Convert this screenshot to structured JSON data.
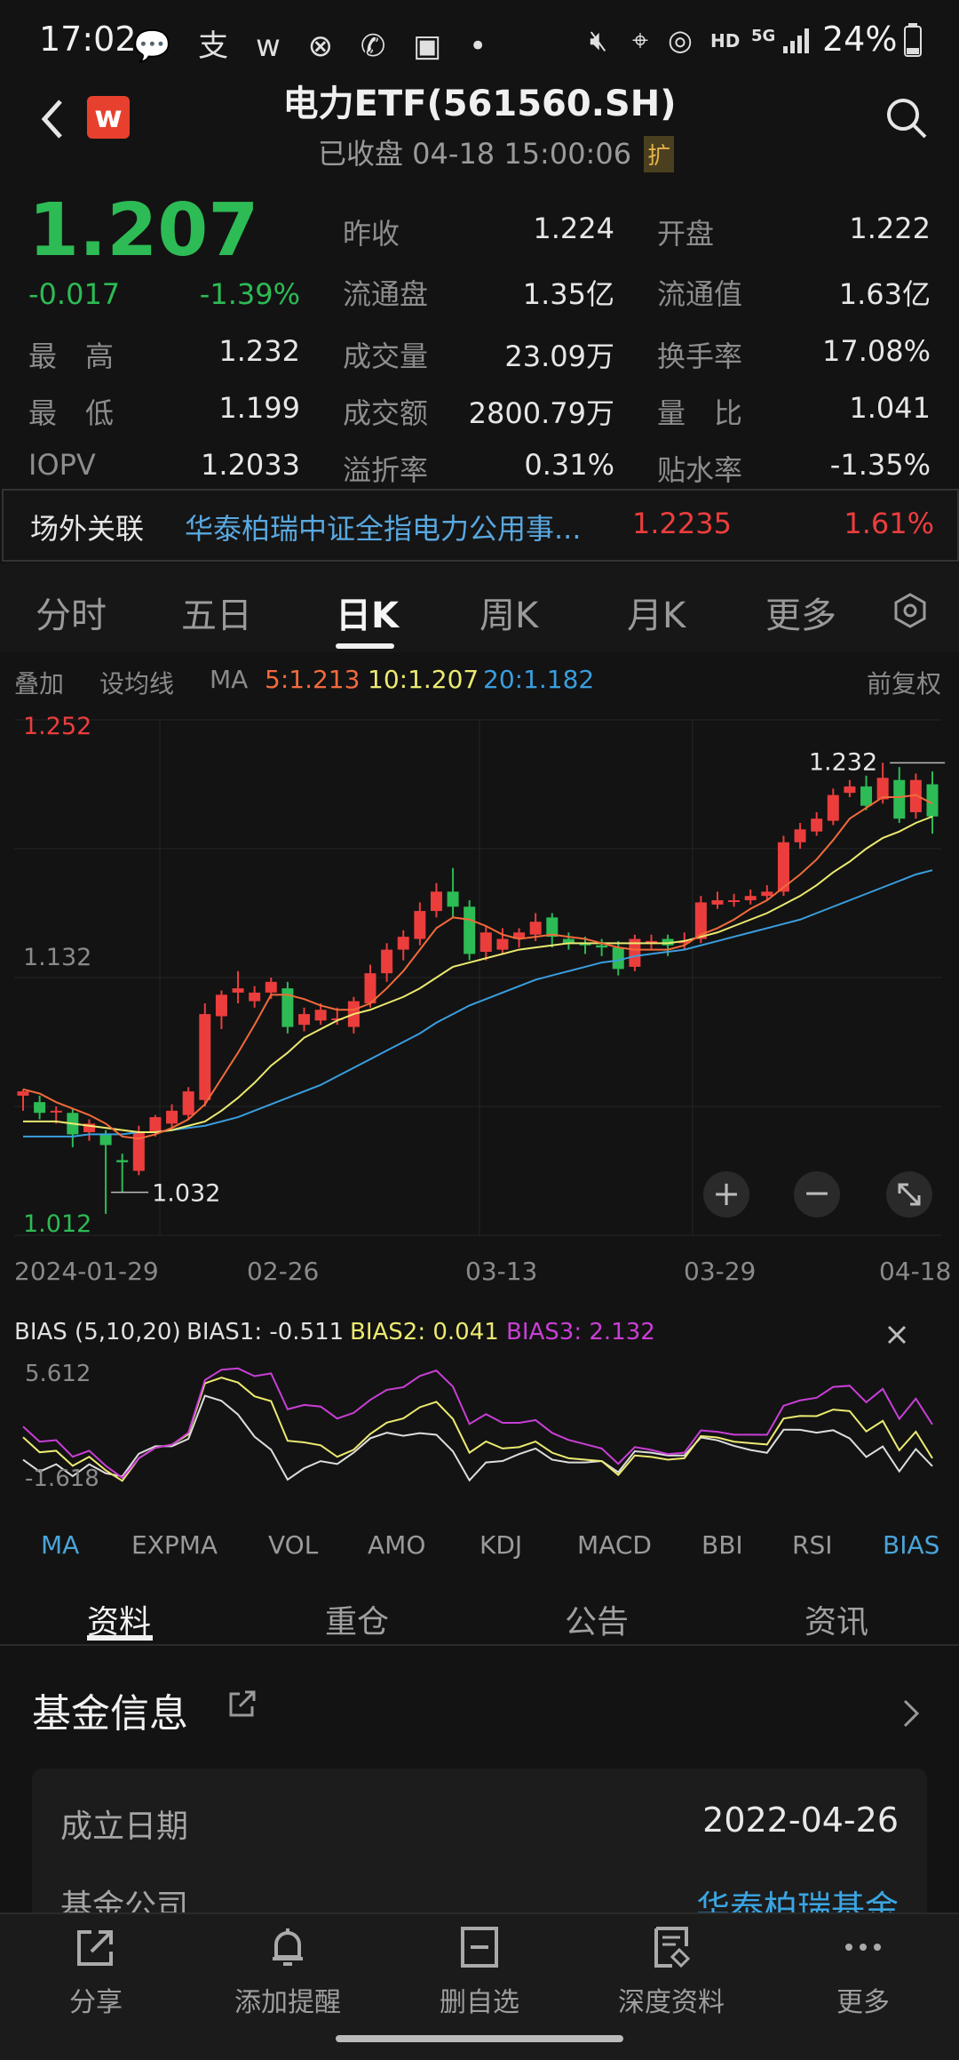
{
  "status_bar": {
    "time": "17:02",
    "battery": "24%",
    "net": "HD",
    "net2": "5G"
  },
  "header": {
    "title": "电力ETF(561560.SH)",
    "subtitle": "已收盘 04-18 15:00:06",
    "expand": "扩"
  },
  "quote": {
    "price": "1.207",
    "change": "-0.017",
    "change_pct": "-1.39%",
    "high_label": "最　高",
    "high": "1.232",
    "low_label": "最　低",
    "low": "1.199",
    "iopv_label": "IOPV",
    "iopv": "1.2033",
    "prev_close_label": "昨收",
    "prev_close": "1.224",
    "open_label": "开盘",
    "open": "1.222",
    "float_shares_label": "流通盘",
    "float_shares": "1.35亿",
    "float_value_label": "流通值",
    "float_value": "1.63亿",
    "volume_label": "成交量",
    "volume": "23.09万",
    "turnover_rate_label": "换手率",
    "turnover_rate": "17.08%",
    "amount_label": "成交额",
    "amount": "2800.79万",
    "vol_ratio_label": "量　比",
    "vol_ratio": "1.041",
    "premium_label": "溢折率",
    "premium": "0.31%",
    "discount_label": "贴水率",
    "discount": "-1.35%"
  },
  "related": {
    "label": "场外关联",
    "name": "华泰柏瑞中证全指电力公用事...",
    "value": "1.2235",
    "pct": "1.61%"
  },
  "period_tabs": [
    "分时",
    "五日",
    "日K",
    "周K",
    "月K",
    "更多"
  ],
  "ma_bar": {
    "overlay": "叠加",
    "set_ma": "设均线",
    "ma": "MA",
    "ma5": "5:1.213",
    "ma10": "10:1.207",
    "ma20": "20:1.182",
    "adjust": "前复权"
  },
  "colors": {
    "up": "#ec3d3d",
    "down": "#2dbb55",
    "ma5": "#f26a3b",
    "ma10": "#ecea70",
    "ma20": "#3a9ede",
    "bias3": "#c93fd6"
  },
  "chart_data": {
    "type": "candlestick",
    "y_max_label": "1.252",
    "y_mid_label": "1.132",
    "y_min_label": "1.012",
    "max_marker": "1.232",
    "min_marker": "1.032",
    "x_labels": [
      "2024-01-29",
      "02-26",
      "03-13",
      "03-29",
      "04-18"
    ],
    "candles": [
      [
        1.077,
        1.079,
        1.08,
        1.07
      ],
      [
        1.074,
        1.069,
        1.077,
        1.066
      ],
      [
        1.07,
        1.07,
        1.072,
        1.064
      ],
      [
        1.069,
        1.059,
        1.071,
        1.053
      ],
      [
        1.06,
        1.064,
        1.066,
        1.056
      ],
      [
        1.059,
        1.054,
        1.061,
        1.022
      ],
      [
        1.047,
        1.046,
        1.05,
        1.032
      ],
      [
        1.042,
        1.06,
        1.063,
        1.04
      ],
      [
        1.06,
        1.067,
        1.068,
        1.058
      ],
      [
        1.064,
        1.07,
        1.073,
        1.062
      ],
      [
        1.068,
        1.079,
        1.081,
        1.066
      ],
      [
        1.075,
        1.115,
        1.12,
        1.072
      ],
      [
        1.114,
        1.124,
        1.126,
        1.108
      ],
      [
        1.125,
        1.127,
        1.135,
        1.12
      ],
      [
        1.121,
        1.125,
        1.128,
        1.118
      ],
      [
        1.125,
        1.13,
        1.132,
        1.122
      ],
      [
        1.127,
        1.109,
        1.13,
        1.106
      ],
      [
        1.11,
        1.115,
        1.118,
        1.107
      ],
      [
        1.112,
        1.117,
        1.12,
        1.11
      ],
      [
        1.113,
        1.113,
        1.118,
        1.11
      ],
      [
        1.109,
        1.121,
        1.123,
        1.106
      ],
      [
        1.12,
        1.134,
        1.138,
        1.118
      ],
      [
        1.134,
        1.145,
        1.148,
        1.13
      ],
      [
        1.145,
        1.151,
        1.154,
        1.14
      ],
      [
        1.15,
        1.163,
        1.167,
        1.147
      ],
      [
        1.163,
        1.172,
        1.176,
        1.16
      ],
      [
        1.172,
        1.165,
        1.183,
        1.16
      ],
      [
        1.165,
        1.143,
        1.168,
        1.14
      ],
      [
        1.144,
        1.153,
        1.156,
        1.14
      ],
      [
        1.145,
        1.15,
        1.155,
        1.143
      ],
      [
        1.15,
        1.153,
        1.155,
        1.146
      ],
      [
        1.152,
        1.158,
        1.162,
        1.149
      ],
      [
        1.16,
        1.151,
        1.162,
        1.146
      ],
      [
        1.15,
        1.148,
        1.153,
        1.145
      ],
      [
        1.148,
        1.147,
        1.151,
        1.143
      ],
      [
        1.147,
        1.146,
        1.15,
        1.142
      ],
      [
        1.146,
        1.136,
        1.149,
        1.133
      ],
      [
        1.137,
        1.15,
        1.152,
        1.135
      ],
      [
        1.149,
        1.149,
        1.152,
        1.145
      ],
      [
        1.15,
        1.147,
        1.152,
        1.142
      ],
      [
        1.148,
        1.149,
        1.153,
        1.145
      ],
      [
        1.15,
        1.167,
        1.17,
        1.148
      ],
      [
        1.166,
        1.168,
        1.172,
        1.164
      ],
      [
        1.168,
        1.168,
        1.171,
        1.165
      ],
      [
        1.168,
        1.17,
        1.173,
        1.166
      ],
      [
        1.17,
        1.172,
        1.175,
        1.168
      ],
      [
        1.172,
        1.195,
        1.198,
        1.17
      ],
      [
        1.195,
        1.201,
        1.204,
        1.192
      ],
      [
        1.2,
        1.206,
        1.209,
        1.198
      ],
      [
        1.205,
        1.217,
        1.22,
        1.203
      ],
      [
        1.218,
        1.221,
        1.224,
        1.216
      ],
      [
        1.221,
        1.212,
        1.226,
        1.21
      ],
      [
        1.215,
        1.225,
        1.232,
        1.213
      ],
      [
        1.224,
        1.206,
        1.23,
        1.204
      ],
      [
        1.209,
        1.224,
        1.227,
        1.206
      ],
      [
        1.222,
        1.207,
        1.228,
        1.199
      ]
    ],
    "ma5": [
      1.08,
      1.078,
      1.074,
      1.071,
      1.068,
      1.064,
      1.058,
      1.057,
      1.059,
      1.062,
      1.066,
      1.073,
      1.085,
      1.097,
      1.11,
      1.124,
      1.124,
      1.122,
      1.119,
      1.117,
      1.117,
      1.12,
      1.127,
      1.135,
      1.145,
      1.155,
      1.16,
      1.159,
      1.156,
      1.152,
      1.15,
      1.151,
      1.152,
      1.151,
      1.15,
      1.148,
      1.146,
      1.145,
      1.145,
      1.145,
      1.147,
      1.152,
      1.155,
      1.159,
      1.164,
      1.168,
      1.174,
      1.18,
      1.187,
      1.196,
      1.206,
      1.211,
      1.216,
      1.216,
      1.217,
      1.213
    ],
    "ma10": [
      1.065,
      1.065,
      1.065,
      1.064,
      1.063,
      1.062,
      1.061,
      1.06,
      1.06,
      1.061,
      1.063,
      1.065,
      1.07,
      1.076,
      1.083,
      1.091,
      1.097,
      1.104,
      1.108,
      1.112,
      1.115,
      1.117,
      1.12,
      1.123,
      1.127,
      1.132,
      1.137,
      1.139,
      1.141,
      1.143,
      1.145,
      1.146,
      1.147,
      1.148,
      1.148,
      1.148,
      1.148,
      1.148,
      1.148,
      1.148,
      1.149,
      1.151,
      1.153,
      1.156,
      1.159,
      1.162,
      1.166,
      1.17,
      1.175,
      1.181,
      1.186,
      1.192,
      1.197,
      1.2,
      1.204,
      1.207
    ],
    "ma20": [
      1.058,
      1.058,
      1.058,
      1.058,
      1.059,
      1.059,
      1.059,
      1.06,
      1.06,
      1.061,
      1.062,
      1.063,
      1.065,
      1.067,
      1.07,
      1.073,
      1.076,
      1.079,
      1.082,
      1.086,
      1.09,
      1.094,
      1.098,
      1.102,
      1.106,
      1.111,
      1.115,
      1.119,
      1.122,
      1.125,
      1.128,
      1.131,
      1.133,
      1.135,
      1.137,
      1.139,
      1.14,
      1.142,
      1.143,
      1.144,
      1.145,
      1.147,
      1.149,
      1.151,
      1.153,
      1.155,
      1.157,
      1.159,
      1.162,
      1.165,
      1.168,
      1.171,
      1.174,
      1.177,
      1.18,
      1.182
    ]
  },
  "bias": {
    "label": "BIAS (5,10,20)",
    "b1": "BIAS1: -0.511",
    "b2": "BIAS2: 0.041",
    "b3": "BIAS3: 2.132",
    "max_label": "5.612",
    "min_label": "-1.618"
  },
  "indicator_tabs": [
    "MA",
    "EXPMA",
    "VOL",
    "AMO",
    "KDJ",
    "MACD",
    "BBI",
    "RSI",
    "BIAS"
  ],
  "bottom_tabs": [
    "资料",
    "重仓",
    "公告",
    "资讯"
  ],
  "fund_info": {
    "title": "基金信息",
    "date_label": "成立日期",
    "date": "2022-04-26",
    "company_label": "基金公司",
    "company": "华泰柏瑞基金"
  },
  "nav": [
    "分享",
    "添加提醒",
    "删自选",
    "深度资料",
    "更多"
  ]
}
